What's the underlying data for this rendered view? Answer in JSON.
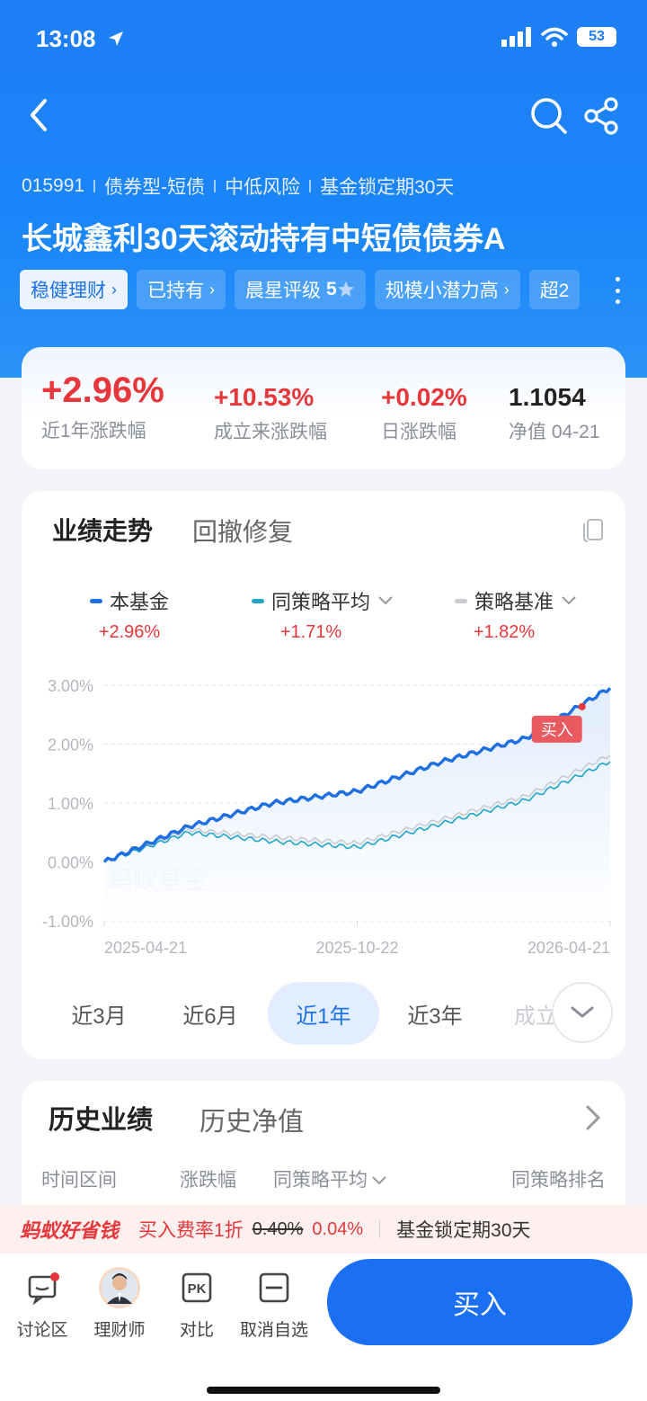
{
  "status": {
    "time": "13:08",
    "battery": "53"
  },
  "fund": {
    "code": "015991",
    "type": "债券型-短债",
    "risk": "中低风险",
    "lock": "基金锁定期30天",
    "name": "长城鑫利30天滚动持有中短债债券A"
  },
  "tags": [
    {
      "label": "稳健理财"
    },
    {
      "label": "已持有"
    },
    {
      "label": "晨星评级",
      "rating": "5"
    },
    {
      "label": "规模小潜力高"
    },
    {
      "label": "超2"
    }
  ],
  "stats": [
    {
      "value": "+2.96%",
      "label": "近1年涨跌幅"
    },
    {
      "value": "+10.53%",
      "label": "成立来涨跌幅"
    },
    {
      "value": "+0.02%",
      "label": "日涨跌幅"
    },
    {
      "value": "1.1054",
      "label": "净值 04-21"
    }
  ],
  "performance": {
    "tabs": [
      "业绩走势",
      "回撤修复"
    ],
    "legend": [
      {
        "name": "本基金",
        "value": "+2.96%",
        "color": "#1f6fe0"
      },
      {
        "name": "同策略平均",
        "value": "+1.71%",
        "color": "#20a6c9"
      },
      {
        "name": "策略基准",
        "value": "+1.82%",
        "color": "#c8cbd0"
      }
    ],
    "watermark": "蚂蚁基金",
    "buy_marker": "买入",
    "ranges": [
      "近3月",
      "近6月",
      "近1年",
      "近3年",
      "成立来"
    ],
    "active_range": "近1年"
  },
  "chart_data": {
    "type": "line",
    "x": [
      "2025-04-21",
      "2025-06-21",
      "2025-08-21",
      "2025-10-22",
      "2025-12-21",
      "2026-02-21",
      "2026-04-21"
    ],
    "series": [
      {
        "name": "本基金",
        "values": [
          0.0,
          0.6,
          1.0,
          1.2,
          1.7,
          2.1,
          2.96
        ]
      },
      {
        "name": "同策略平均",
        "values": [
          0.0,
          0.5,
          0.35,
          0.25,
          0.65,
          1.05,
          1.71
        ]
      },
      {
        "name": "策略基准",
        "values": [
          0.0,
          0.55,
          0.42,
          0.32,
          0.72,
          1.12,
          1.82
        ]
      }
    ],
    "yticks": [
      "3.00%",
      "2.00%",
      "1.00%",
      "0.00%",
      "-1.00%"
    ],
    "xticks": [
      "2025-04-21",
      "2025-10-22",
      "2026-04-21"
    ],
    "ylim": [
      -1.0,
      3.0
    ],
    "grid": true
  },
  "history": {
    "tabs": [
      "历史业绩",
      "历史净值"
    ],
    "columns": [
      "时间区间",
      "涨跌幅",
      "同策略平均",
      "同策略排名"
    ]
  },
  "promo": {
    "brand": "蚂蚁好省钱",
    "fee_label": "买入费率1折",
    "old_rate": "0.40%",
    "new_rate": "0.04%",
    "lock": "基金锁定期30天"
  },
  "bottom": {
    "items": [
      "讨论区",
      "理财师",
      "对比",
      "取消自选"
    ],
    "buy": "买入"
  }
}
